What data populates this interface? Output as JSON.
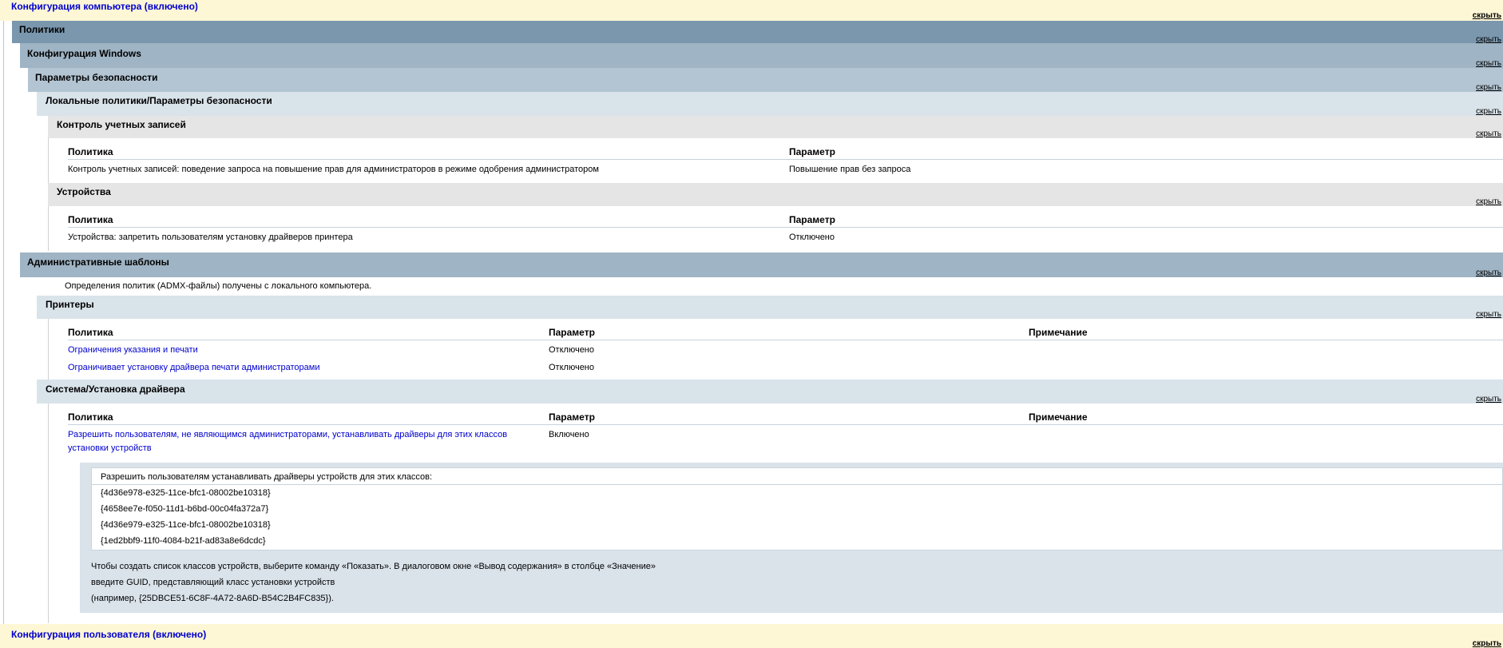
{
  "hide_label": "скрыть",
  "computer_config": {
    "title": "Конфигурация компьютера (включено)"
  },
  "policies": {
    "title": "Политики"
  },
  "windows_config": {
    "title": "Конфигурация Windows"
  },
  "security_settings": {
    "title": "Параметры безопасности"
  },
  "local_policies": {
    "title": "Локальные политики/Параметры безопасности"
  },
  "uac": {
    "title": "Контроль учетных записей",
    "columns": [
      "Политика",
      "Параметр"
    ],
    "rows": [
      {
        "policy": "Контроль учетных записей: поведение запроса на повышение прав для администраторов в режиме одобрения администратором",
        "setting": "Повышение прав без запроса"
      }
    ]
  },
  "devices": {
    "title": "Устройства",
    "columns": [
      "Политика",
      "Параметр"
    ],
    "rows": [
      {
        "policy": "Устройства: запретить пользователям установку драйверов принтера",
        "setting": "Отключено"
      }
    ]
  },
  "admin_templates": {
    "title": "Административные шаблоны",
    "note": "Определения политик (ADMX-файлы) получены с локального компьютера."
  },
  "printers": {
    "title": "Принтеры",
    "columns": [
      "Политика",
      "Параметр",
      "Примечание"
    ],
    "rows": [
      {
        "policy": "Ограничения указания и печати",
        "setting": "Отключено"
      },
      {
        "policy": "Ограничивает установку драйвера печати администраторами",
        "setting": "Отключено"
      }
    ]
  },
  "driver_install": {
    "title": "Система/Установка драйвера",
    "columns": [
      "Политика",
      "Параметр",
      "Примечание"
    ],
    "rows": [
      {
        "policy_line1": "Разрешить пользователям, не являющимся администраторами, устанавливать драйверы для этих классов",
        "policy_line2": "установки устройств",
        "setting": "Включено"
      }
    ],
    "detail": {
      "header": "Разрешить пользователям устанавливать драйверы устройств для этих классов:",
      "guids": [
        "{4d36e978-e325-11ce-bfc1-08002be10318}",
        "{4658ee7e-f050-11d1-b6bd-00c04fa372a7}",
        "{4d36e979-e325-11ce-bfc1-08002be10318}",
        "{1ed2bbf9-11f0-4084-b21f-ad83a8e6dcdc}"
      ],
      "explain": [
        "Чтобы создать список классов устройств, выберите команду «Показать». В диалоговом окне «Вывод содержания» в столбце «Значение»",
        "введите GUID, представляющий класс установки устройств",
        "(например, {25DBCE51-6C8F-4A72-8A6D-B54C2B4FC835})."
      ]
    }
  },
  "user_config": {
    "title": "Конфигурация пользователя (включено)"
  }
}
